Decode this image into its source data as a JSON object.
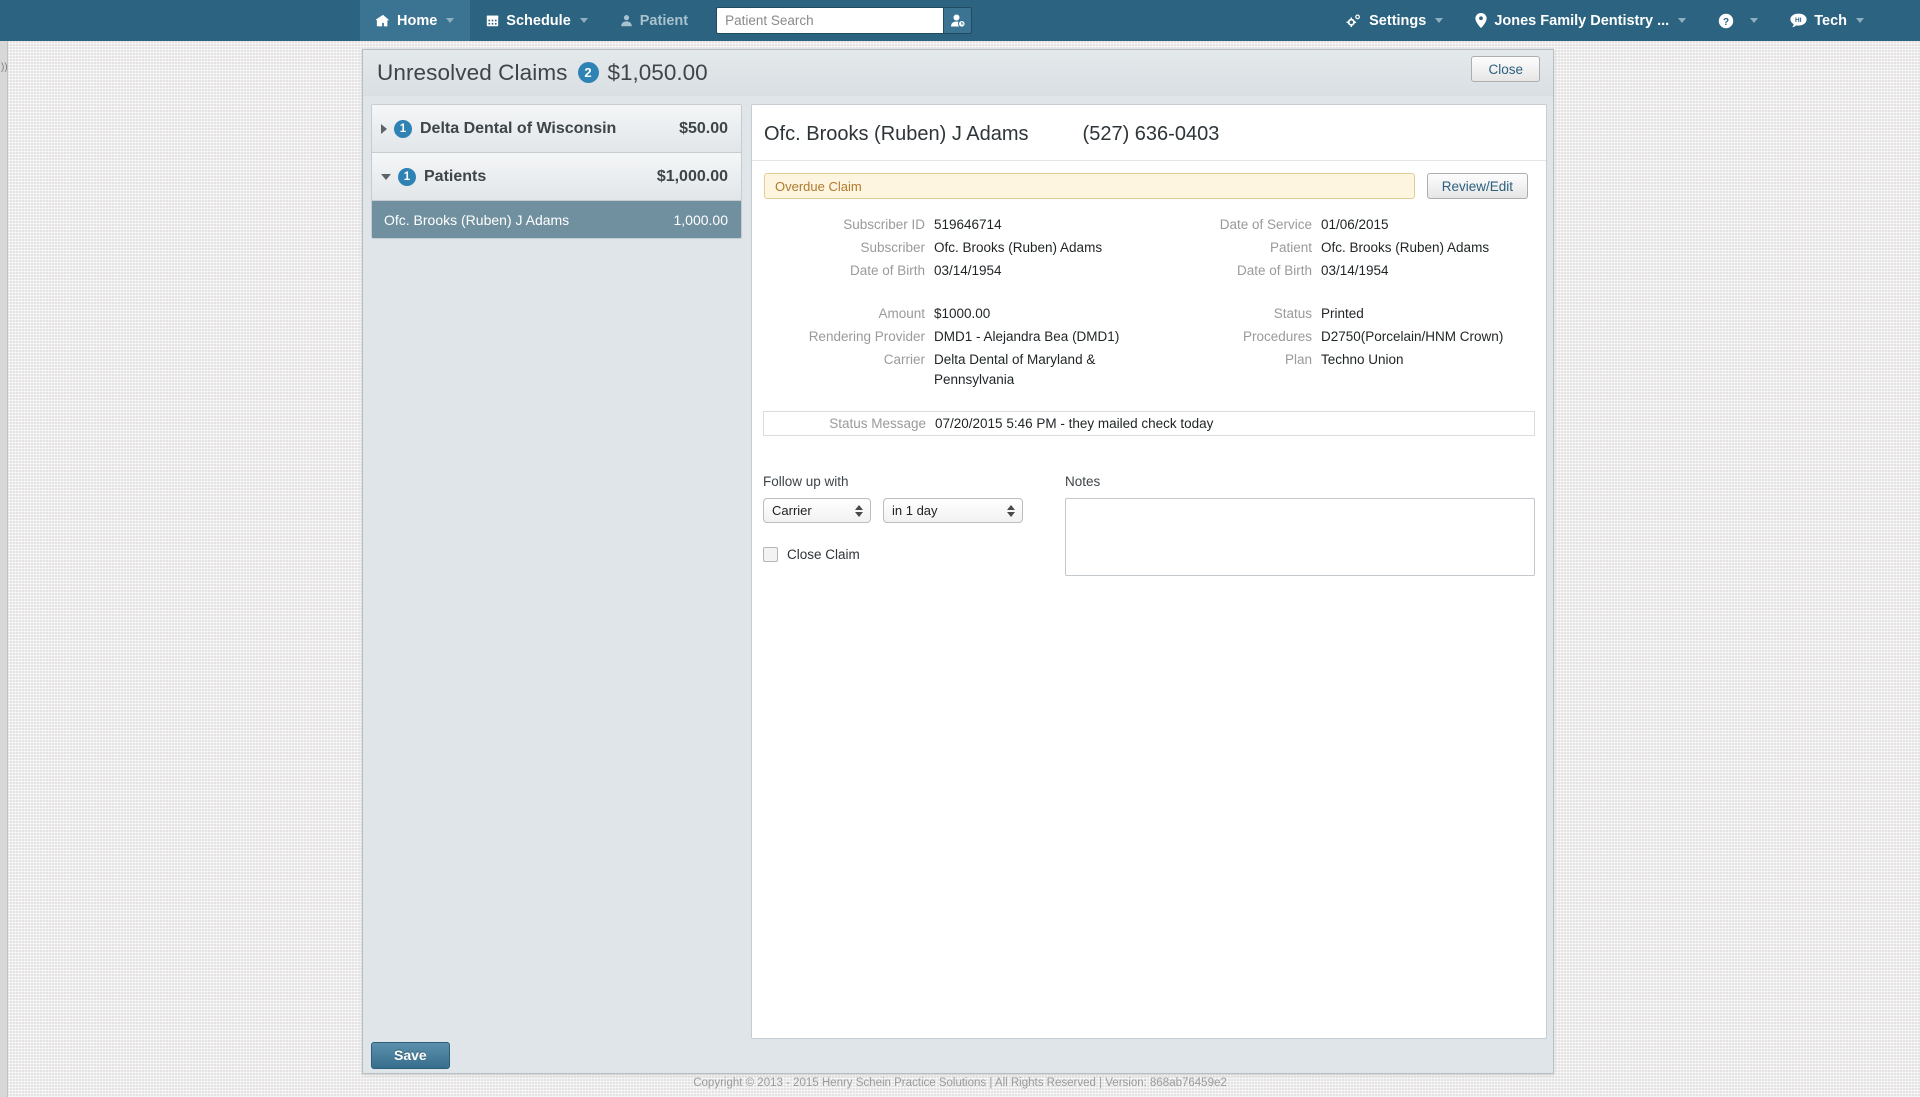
{
  "nav": {
    "items": [
      {
        "label": "Home",
        "icon": "home-icon",
        "active": true,
        "caret": true
      },
      {
        "label": "Schedule",
        "icon": "calendar-icon",
        "active": false,
        "caret": true
      },
      {
        "label": "Patient",
        "icon": "person-icon",
        "active": false,
        "caret": false
      }
    ],
    "search": {
      "placeholder": "Patient Search",
      "value": "",
      "button_icon": "add-patient-icon"
    },
    "right_items": [
      {
        "label": "Settings",
        "icon": "gear-icon",
        "caret": true
      },
      {
        "label": "Jones Family Dentistry ...",
        "icon": "location-pin-icon",
        "caret": true
      },
      {
        "label": "",
        "icon": "help-circle-icon",
        "caret": true
      },
      {
        "label": "Tech",
        "icon": "chat-bubble-icon",
        "caret": true
      }
    ]
  },
  "panel": {
    "title": "Unresolved Claims",
    "count": "2",
    "total": "$1,050.00",
    "close_label": "Close",
    "save_label": "Save"
  },
  "sidebar": {
    "groups": [
      {
        "label": "Delta Dental of Wisconsin",
        "badge": "1",
        "amount": "$50.00",
        "expanded": false,
        "children": []
      },
      {
        "label": "Patients",
        "badge": "1",
        "amount": "$1,000.00",
        "expanded": true,
        "children": [
          {
            "label": "Ofc. Brooks (Ruben) J Adams",
            "amount": "1,000.00",
            "selected": true
          }
        ]
      }
    ]
  },
  "detail": {
    "patient_name": "Ofc. Brooks (Ruben) J Adams",
    "phone": "(527) 636-0403",
    "alert_text": "Overdue Claim",
    "review_label": "Review/Edit",
    "left_fields_top": [
      {
        "label": "Subscriber ID",
        "value": "519646714"
      },
      {
        "label": "Subscriber",
        "value": "Ofc. Brooks (Ruben) Adams"
      },
      {
        "label": "Date of Birth",
        "value": "03/14/1954"
      }
    ],
    "right_fields_top": [
      {
        "label": "Date of Service",
        "value": "01/06/2015"
      },
      {
        "label": "Patient",
        "value": "Ofc. Brooks (Ruben) Adams"
      },
      {
        "label": "Date of Birth",
        "value": "03/14/1954"
      }
    ],
    "left_fields_bottom": [
      {
        "label": "Amount",
        "value": "$1000.00"
      },
      {
        "label": "Rendering Provider",
        "value": "DMD1 - Alejandra Bea (DMD1)"
      },
      {
        "label": "Carrier",
        "value": "Delta Dental of Maryland & Pennsylvania"
      }
    ],
    "right_fields_bottom": [
      {
        "label": "Status",
        "value": "Printed"
      },
      {
        "label": "Procedures",
        "value": "D2750(Porcelain/HNM Crown)"
      },
      {
        "label": "Plan",
        "value": "Techno Union"
      }
    ],
    "status_message_label": "Status Message",
    "status_message_value": "07/20/2015 5:46 PM - they mailed check today",
    "followup_title": "Follow up with",
    "followup_with": "Carrier",
    "followup_when": "in 1 day",
    "close_claim_label": "Close Claim",
    "close_claim_checked": false,
    "notes_title": "Notes",
    "notes_value": ""
  },
  "footer": {
    "copyright": "Copyright © 2013 - 2015 Henry Schein Practice Solutions | All Rights Reserved | Version: 868ab76459e2"
  },
  "colors": {
    "nav_bg": "#2b6380",
    "nav_active": "#3b7493",
    "accent_badge": "#2f83b4",
    "row_selected": "#70909f",
    "alert_bg": "#fdf5e0",
    "alert_border": "#e2cd9a",
    "alert_text": "#b07a2a",
    "save_btn": "#376e8c"
  }
}
